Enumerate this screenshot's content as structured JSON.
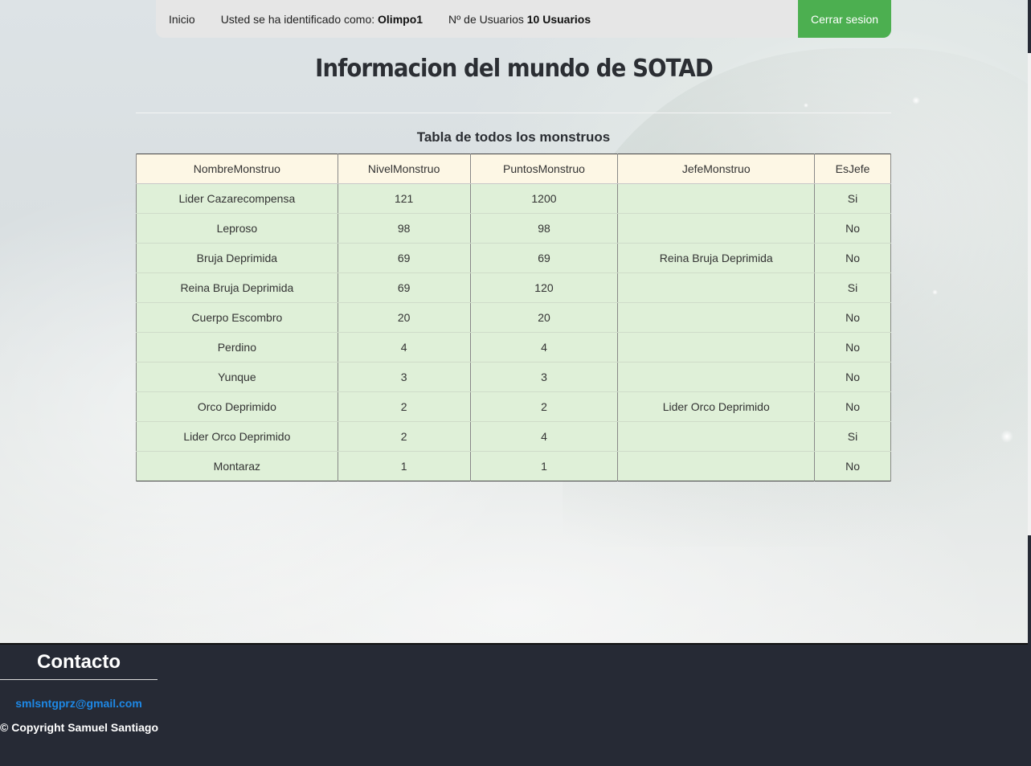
{
  "nav": {
    "home": "Inicio",
    "logged_prefix": "Usted se ha identificado como: ",
    "username": "Olimpo1",
    "users_prefix": "Nº de Usuarios ",
    "users_count": "10 Usuarios",
    "logout": "Cerrar sesion"
  },
  "page": {
    "title": "Informacion del mundo de SOTAD",
    "table_caption": "Tabla de todos los monstruos"
  },
  "table": {
    "headers": [
      "NombreMonstruo",
      "NivelMonstruo",
      "PuntosMonstruo",
      "JefeMonstruo",
      "EsJefe"
    ],
    "rows": [
      [
        "Lider Cazarecompensa",
        "121",
        "1200",
        "",
        "Si"
      ],
      [
        "Leproso",
        "98",
        "98",
        "",
        "No"
      ],
      [
        "Bruja Deprimida",
        "69",
        "69",
        "Reina Bruja Deprimida",
        "No"
      ],
      [
        "Reina Bruja Deprimida",
        "69",
        "120",
        "",
        "Si"
      ],
      [
        "Cuerpo Escombro",
        "20",
        "20",
        "",
        "No"
      ],
      [
        "Perdino",
        "4",
        "4",
        "",
        "No"
      ],
      [
        "Yunque",
        "3",
        "3",
        "",
        "No"
      ],
      [
        "Orco Deprimido",
        "2",
        "2",
        "Lider Orco Deprimido",
        "No"
      ],
      [
        "Lider Orco Deprimido",
        "2",
        "4",
        "",
        "Si"
      ],
      [
        "Montaraz",
        "1",
        "1",
        "",
        "No"
      ]
    ]
  },
  "footer": {
    "contact_title": "Contacto",
    "email": "smlsntgprz@gmail.com",
    "copyright": "© Copyright Samuel Santiago"
  },
  "colors": {
    "logout_bg": "#4caf50",
    "table_header_bg": "#fdf7e5",
    "table_row_bg": "#dff0d8",
    "footer_bg": "#262a35",
    "email_link": "#1e88e5"
  }
}
